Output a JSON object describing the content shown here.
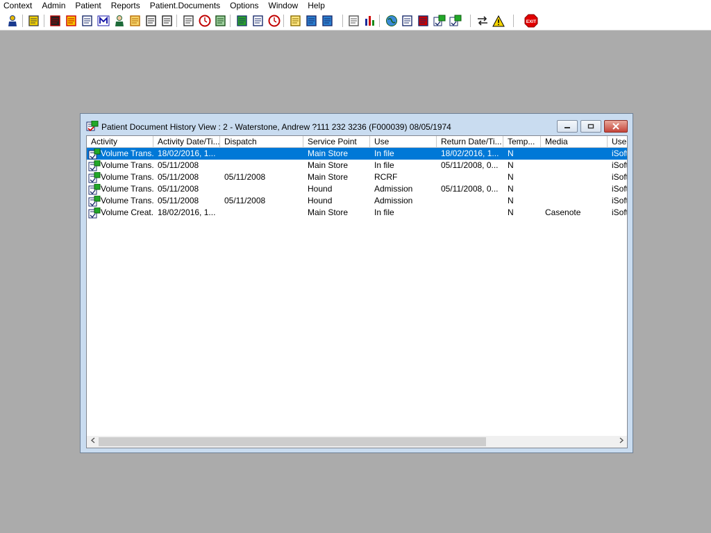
{
  "menu": [
    "Context",
    "Admin",
    "Patient",
    "Reports",
    "Patient.Documents",
    "Options",
    "Window",
    "Help"
  ],
  "toolbar": {
    "icons": [
      "patient-search-icon",
      "print-icon",
      "book-icon",
      "record-edit-icon",
      "document-list-icon",
      "mail-m-icon",
      "person-icon",
      "folder-edit-icon",
      "flag-icon",
      "flag-return-icon",
      "search-document-icon",
      "clock-icon",
      "monitor-icon",
      "display-chart-icon",
      "edit-card-icon",
      "no-entry-icon",
      "note-icon",
      "transfer-icon",
      "user-transfer-icon",
      "blank-page-icon",
      "bar-chart-icon",
      "globe-icon",
      "document-check-icon",
      "document-tick-icon",
      "document-green-icon",
      "document-volume-icon",
      "swap-arrows-icon",
      "warning-icon"
    ],
    "exit_label": "EXIT"
  },
  "window": {
    "title": "Patient Document History View : 2 - Waterstone, Andrew ?111 232 3236 (F000039) 08/05/1974",
    "columns": [
      "Activity",
      "Activity Date/Ti...",
      "Dispatch",
      "Service Point",
      "Use",
      "Return Date/Ti...",
      "Temp...",
      "Media",
      "User"
    ],
    "rows": [
      {
        "activity": "Volume Trans...",
        "activity_date": "18/02/2016, 1...",
        "dispatch": "",
        "service_point": "Main Store",
        "use": "In file",
        "return_date": "18/02/2016, 1...",
        "temp": "N",
        "media": "",
        "user": "iSoft"
      },
      {
        "activity": "Volume Trans...",
        "activity_date": "05/11/2008",
        "dispatch": "",
        "service_point": "Main Store",
        "use": "In file",
        "return_date": "05/11/2008, 0...",
        "temp": "N",
        "media": "",
        "user": "iSoft"
      },
      {
        "activity": "Volume Trans...",
        "activity_date": "05/11/2008",
        "dispatch": "05/11/2008",
        "service_point": "Main Store",
        "use": "RCRF",
        "return_date": "",
        "temp": "N",
        "media": "",
        "user": "iSoft"
      },
      {
        "activity": "Volume Trans...",
        "activity_date": "05/11/2008",
        "dispatch": "",
        "service_point": "Hound",
        "use": "Admission",
        "return_date": "05/11/2008, 0...",
        "temp": "N",
        "media": "",
        "user": "iSoft"
      },
      {
        "activity": "Volume Trans...",
        "activity_date": "05/11/2008",
        "dispatch": "05/11/2008",
        "service_point": "Hound",
        "use": "Admission",
        "return_date": "",
        "temp": "N",
        "media": "",
        "user": "iSoft"
      },
      {
        "activity": "Volume Creat...",
        "activity_date": "18/02/2016, 1...",
        "dispatch": "",
        "service_point": "Main Store",
        "use": "In file",
        "return_date": "",
        "temp": "N",
        "media": "Casenote",
        "user": "iSoft"
      }
    ]
  },
  "colors": {
    "desktop": "#ababab",
    "selection": "#0078d7",
    "window_frame": "#c9dcf0",
    "close_button": "#c5453a",
    "exit_icon": "#e00000"
  }
}
